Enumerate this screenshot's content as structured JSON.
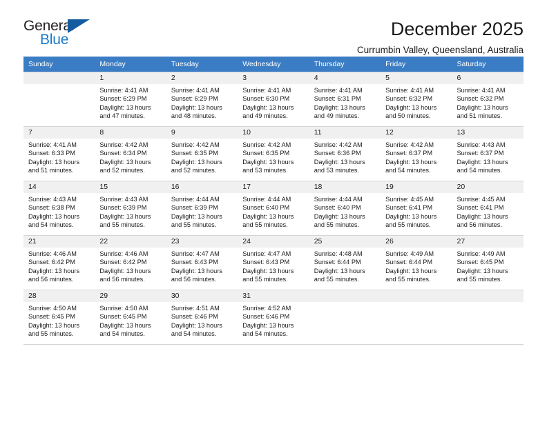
{
  "logo": {
    "word_one": "General",
    "word_two": "Blue",
    "triangle_color": "#135ca0",
    "blue_color": "#1b79c9"
  },
  "header": {
    "title": "December 2025",
    "subtitle": "Currumbin Valley, Queensland, Australia",
    "accent_color": "#3b7dc4"
  },
  "calendar": {
    "weekday_headers": [
      "Sunday",
      "Monday",
      "Tuesday",
      "Wednesday",
      "Thursday",
      "Friday",
      "Saturday"
    ],
    "weeks": [
      [
        {
          "day": "",
          "lines": []
        },
        {
          "day": "1",
          "lines": [
            "Sunrise: 4:41 AM",
            "Sunset: 6:29 PM",
            "Daylight: 13 hours",
            "and 47 minutes."
          ]
        },
        {
          "day": "2",
          "lines": [
            "Sunrise: 4:41 AM",
            "Sunset: 6:29 PM",
            "Daylight: 13 hours",
            "and 48 minutes."
          ]
        },
        {
          "day": "3",
          "lines": [
            "Sunrise: 4:41 AM",
            "Sunset: 6:30 PM",
            "Daylight: 13 hours",
            "and 49 minutes."
          ]
        },
        {
          "day": "4",
          "lines": [
            "Sunrise: 4:41 AM",
            "Sunset: 6:31 PM",
            "Daylight: 13 hours",
            "and 49 minutes."
          ]
        },
        {
          "day": "5",
          "lines": [
            "Sunrise: 4:41 AM",
            "Sunset: 6:32 PM",
            "Daylight: 13 hours",
            "and 50 minutes."
          ]
        },
        {
          "day": "6",
          "lines": [
            "Sunrise: 4:41 AM",
            "Sunset: 6:32 PM",
            "Daylight: 13 hours",
            "and 51 minutes."
          ]
        }
      ],
      [
        {
          "day": "7",
          "lines": [
            "Sunrise: 4:41 AM",
            "Sunset: 6:33 PM",
            "Daylight: 13 hours",
            "and 51 minutes."
          ]
        },
        {
          "day": "8",
          "lines": [
            "Sunrise: 4:42 AM",
            "Sunset: 6:34 PM",
            "Daylight: 13 hours",
            "and 52 minutes."
          ]
        },
        {
          "day": "9",
          "lines": [
            "Sunrise: 4:42 AM",
            "Sunset: 6:35 PM",
            "Daylight: 13 hours",
            "and 52 minutes."
          ]
        },
        {
          "day": "10",
          "lines": [
            "Sunrise: 4:42 AM",
            "Sunset: 6:35 PM",
            "Daylight: 13 hours",
            "and 53 minutes."
          ]
        },
        {
          "day": "11",
          "lines": [
            "Sunrise: 4:42 AM",
            "Sunset: 6:36 PM",
            "Daylight: 13 hours",
            "and 53 minutes."
          ]
        },
        {
          "day": "12",
          "lines": [
            "Sunrise: 4:42 AM",
            "Sunset: 6:37 PM",
            "Daylight: 13 hours",
            "and 54 minutes."
          ]
        },
        {
          "day": "13",
          "lines": [
            "Sunrise: 4:43 AM",
            "Sunset: 6:37 PM",
            "Daylight: 13 hours",
            "and 54 minutes."
          ]
        }
      ],
      [
        {
          "day": "14",
          "lines": [
            "Sunrise: 4:43 AM",
            "Sunset: 6:38 PM",
            "Daylight: 13 hours",
            "and 54 minutes."
          ]
        },
        {
          "day": "15",
          "lines": [
            "Sunrise: 4:43 AM",
            "Sunset: 6:39 PM",
            "Daylight: 13 hours",
            "and 55 minutes."
          ]
        },
        {
          "day": "16",
          "lines": [
            "Sunrise: 4:44 AM",
            "Sunset: 6:39 PM",
            "Daylight: 13 hours",
            "and 55 minutes."
          ]
        },
        {
          "day": "17",
          "lines": [
            "Sunrise: 4:44 AM",
            "Sunset: 6:40 PM",
            "Daylight: 13 hours",
            "and 55 minutes."
          ]
        },
        {
          "day": "18",
          "lines": [
            "Sunrise: 4:44 AM",
            "Sunset: 6:40 PM",
            "Daylight: 13 hours",
            "and 55 minutes."
          ]
        },
        {
          "day": "19",
          "lines": [
            "Sunrise: 4:45 AM",
            "Sunset: 6:41 PM",
            "Daylight: 13 hours",
            "and 55 minutes."
          ]
        },
        {
          "day": "20",
          "lines": [
            "Sunrise: 4:45 AM",
            "Sunset: 6:41 PM",
            "Daylight: 13 hours",
            "and 56 minutes."
          ]
        }
      ],
      [
        {
          "day": "21",
          "lines": [
            "Sunrise: 4:46 AM",
            "Sunset: 6:42 PM",
            "Daylight: 13 hours",
            "and 56 minutes."
          ]
        },
        {
          "day": "22",
          "lines": [
            "Sunrise: 4:46 AM",
            "Sunset: 6:42 PM",
            "Daylight: 13 hours",
            "and 56 minutes."
          ]
        },
        {
          "day": "23",
          "lines": [
            "Sunrise: 4:47 AM",
            "Sunset: 6:43 PM",
            "Daylight: 13 hours",
            "and 56 minutes."
          ]
        },
        {
          "day": "24",
          "lines": [
            "Sunrise: 4:47 AM",
            "Sunset: 6:43 PM",
            "Daylight: 13 hours",
            "and 55 minutes."
          ]
        },
        {
          "day": "25",
          "lines": [
            "Sunrise: 4:48 AM",
            "Sunset: 6:44 PM",
            "Daylight: 13 hours",
            "and 55 minutes."
          ]
        },
        {
          "day": "26",
          "lines": [
            "Sunrise: 4:49 AM",
            "Sunset: 6:44 PM",
            "Daylight: 13 hours",
            "and 55 minutes."
          ]
        },
        {
          "day": "27",
          "lines": [
            "Sunrise: 4:49 AM",
            "Sunset: 6:45 PM",
            "Daylight: 13 hours",
            "and 55 minutes."
          ]
        }
      ],
      [
        {
          "day": "28",
          "lines": [
            "Sunrise: 4:50 AM",
            "Sunset: 6:45 PM",
            "Daylight: 13 hours",
            "and 55 minutes."
          ]
        },
        {
          "day": "29",
          "lines": [
            "Sunrise: 4:50 AM",
            "Sunset: 6:45 PM",
            "Daylight: 13 hours",
            "and 54 minutes."
          ]
        },
        {
          "day": "30",
          "lines": [
            "Sunrise: 4:51 AM",
            "Sunset: 6:46 PM",
            "Daylight: 13 hours",
            "and 54 minutes."
          ]
        },
        {
          "day": "31",
          "lines": [
            "Sunrise: 4:52 AM",
            "Sunset: 6:46 PM",
            "Daylight: 13 hours",
            "and 54 minutes."
          ]
        },
        {
          "day": "",
          "lines": []
        },
        {
          "day": "",
          "lines": []
        },
        {
          "day": "",
          "lines": []
        }
      ]
    ]
  }
}
